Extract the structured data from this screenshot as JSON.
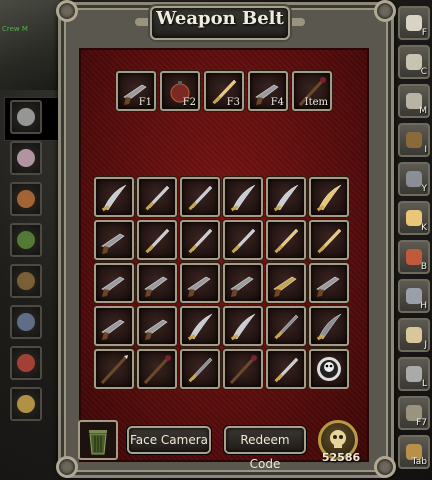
{
  "window": {
    "title": "Weapon Belt"
  },
  "scene": {
    "overhead_text": "Crew M"
  },
  "belt": {
    "slots": [
      {
        "key": "F1",
        "icon": "flintlock-pistol-icon"
      },
      {
        "key": "F2",
        "icon": "grenade-bomb-icon"
      },
      {
        "key": "F3",
        "icon": "broadsword-icon"
      },
      {
        "key": "F4",
        "icon": "blunderbuss-icon"
      },
      {
        "key": "Item",
        "icon": "staff-icon"
      }
    ]
  },
  "inventory": {
    "rows": [
      [
        "cutlass-icon",
        "dagger-icon",
        "rapier-icon",
        "saber-icon",
        "scimitar-icon",
        "golden-cutlass-icon"
      ],
      [
        "musket-icon",
        "ornate-sword-icon",
        "longsword-icon",
        "claymore-icon",
        "fire-sword-icon",
        "gold-hilt-sword-icon"
      ],
      [
        "blunderbuss-icon",
        "musket-icon",
        "flintlock-pistol-icon",
        "double-pistol-icon",
        "gold-pistol-icon",
        "grapeshot-pistol-icon"
      ],
      [
        "dueling-pistol-icon",
        "volley-gun-icon",
        "curved-blade-icon",
        "kris-dagger-icon",
        "ghost-blade-icon",
        "cursed-saber-icon"
      ],
      [
        "spear-icon",
        "voodoo-staff-icon",
        "bone-dagger-icon",
        "dark-staff-icon",
        "sacrifice-knife-icon",
        "skull-doll-icon"
      ]
    ]
  },
  "actions": {
    "face_camera": "Face Camera",
    "redeem_code": "Redeem Code"
  },
  "gold": {
    "amount": "52586"
  },
  "left_tabs": [
    "crossed-pistols-icon",
    "clothing-icon",
    "jewelry-icon",
    "potion-icon",
    "barrel-icon",
    "loot-pile-icon",
    "document-icon",
    "gold-coins-icon"
  ],
  "right_tabs": [
    {
      "key": "F",
      "icon": "journal-icon"
    },
    {
      "key": "C",
      "icon": "compass-icon"
    },
    {
      "key": "M",
      "icon": "map-icon"
    },
    {
      "key": "I",
      "icon": "chest-icon"
    },
    {
      "key": "Y",
      "icon": "weapons-icon"
    },
    {
      "key": "K",
      "icon": "compass-star-icon"
    },
    {
      "key": "B",
      "icon": "skull-badge-icon"
    },
    {
      "key": "H",
      "icon": "ship-icon"
    },
    {
      "key": "J",
      "icon": "book-icon"
    },
    {
      "key": "L",
      "icon": "spyglass-icon"
    },
    {
      "key": "F7",
      "icon": "gears-icon"
    },
    {
      "key": "Tab",
      "icon": "treasure-chest-icon"
    }
  ],
  "colors": {
    "panel_red": "#5c0d0d",
    "frame": "#8d8778",
    "text": "#f0ece0"
  }
}
